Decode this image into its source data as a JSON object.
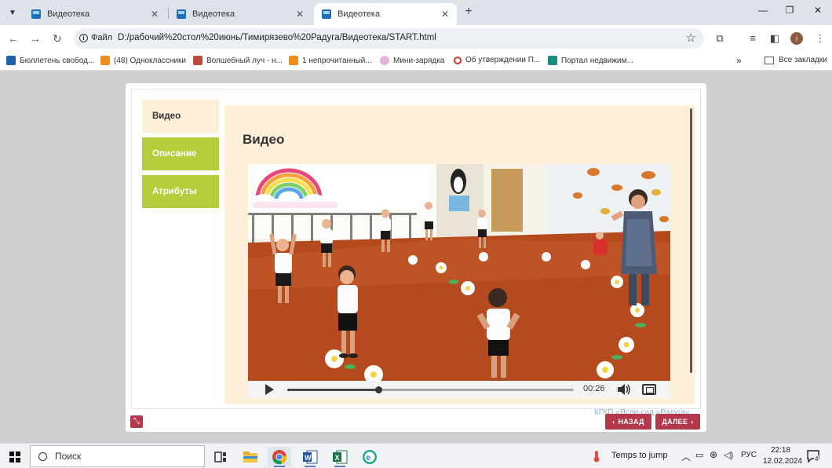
{
  "browser": {
    "tabs": [
      {
        "title": "Видеотека",
        "active": false
      },
      {
        "title": "Видеотека",
        "active": false
      },
      {
        "title": "Видеотека",
        "active": true
      }
    ],
    "new_tab": "+",
    "address": {
      "info_label": "Файл",
      "url": "D:/рабочий%20стол%20июнь/Тимирязево%20Радуга/Видеотека/START.html"
    },
    "profile_initial": "i",
    "bookmarks": [
      {
        "label": "Бюллетень свобод...",
        "icon_color": "#1f5fae"
      },
      {
        "label": "(48) Одноклассники",
        "icon_color": "#f28c1b"
      },
      {
        "label": "Волшебный луч - н...",
        "icon_color": "#c0473a"
      },
      {
        "label": "1 непрочитанный...",
        "icon_color": "#f28c1b"
      },
      {
        "label": "Мини-зарядка",
        "icon_color": "#e4b3d6"
      },
      {
        "label": "Об утверждении П...",
        "icon_color": "#c0392b"
      },
      {
        "label": "Портал недвижим...",
        "icon_color": "#1a8c7c"
      }
    ],
    "bookmarks_more": "»",
    "all_bookmarks": "Все закладки"
  },
  "player": {
    "side_tabs": [
      {
        "label": "Видео",
        "active": true
      },
      {
        "label": "Описание",
        "active": false
      },
      {
        "label": "Атрибуты",
        "active": false
      }
    ],
    "content_title": "Видео",
    "video": {
      "time": "00:26",
      "progress": 0.32
    },
    "credit": "КГКП «Ясли-сад «Радуга»",
    "buttons": {
      "back": "НАЗАД",
      "next": "ДАЛЕЕ"
    },
    "accent_color": "#b2384a",
    "tab_color": "#b5cd3a"
  },
  "taskbar": {
    "search_placeholder": "Поиск",
    "weather": "Temps to jump",
    "language": "РУС",
    "time": "22:18",
    "date": "12.02.2024",
    "notifications": "4"
  }
}
